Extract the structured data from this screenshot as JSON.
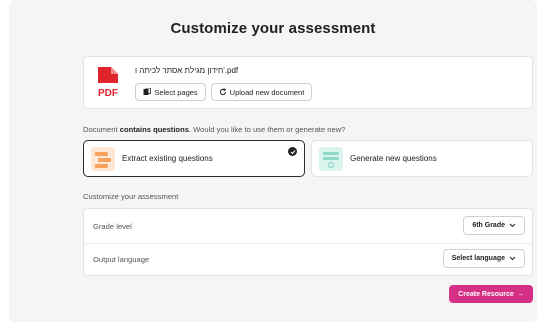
{
  "page": {
    "title": "Customize your assessment"
  },
  "document": {
    "file_name": "חידון מגילת אסתר לכיתה ו'.pdf",
    "file_type_label": "PDF",
    "select_pages_label": "Select pages",
    "upload_new_label": "Upload new document"
  },
  "question_source": {
    "prompt_pre": "Document ",
    "prompt_bold": "contains questions",
    "prompt_post": ". Would you like to use them or generate new?",
    "options": [
      {
        "label": "Extract existing questions",
        "selected": true,
        "icon": "extract-questions-icon"
      },
      {
        "label": "Generate new questions",
        "selected": false,
        "icon": "generate-questions-icon"
      }
    ]
  },
  "customize": {
    "section_label": "Customize your assessment",
    "grade_level": {
      "label": "Grade level",
      "value": "6th Grade"
    },
    "output_language": {
      "label": "Output language",
      "value": "Select language"
    }
  },
  "actions": {
    "create_label": "Create Resource",
    "create_arrow": "→"
  },
  "colors": {
    "accent": "#d62f86",
    "pdf_red": "#e0242c",
    "extract_orange": "#f7a15b",
    "generate_teal": "#8fd9c8"
  }
}
